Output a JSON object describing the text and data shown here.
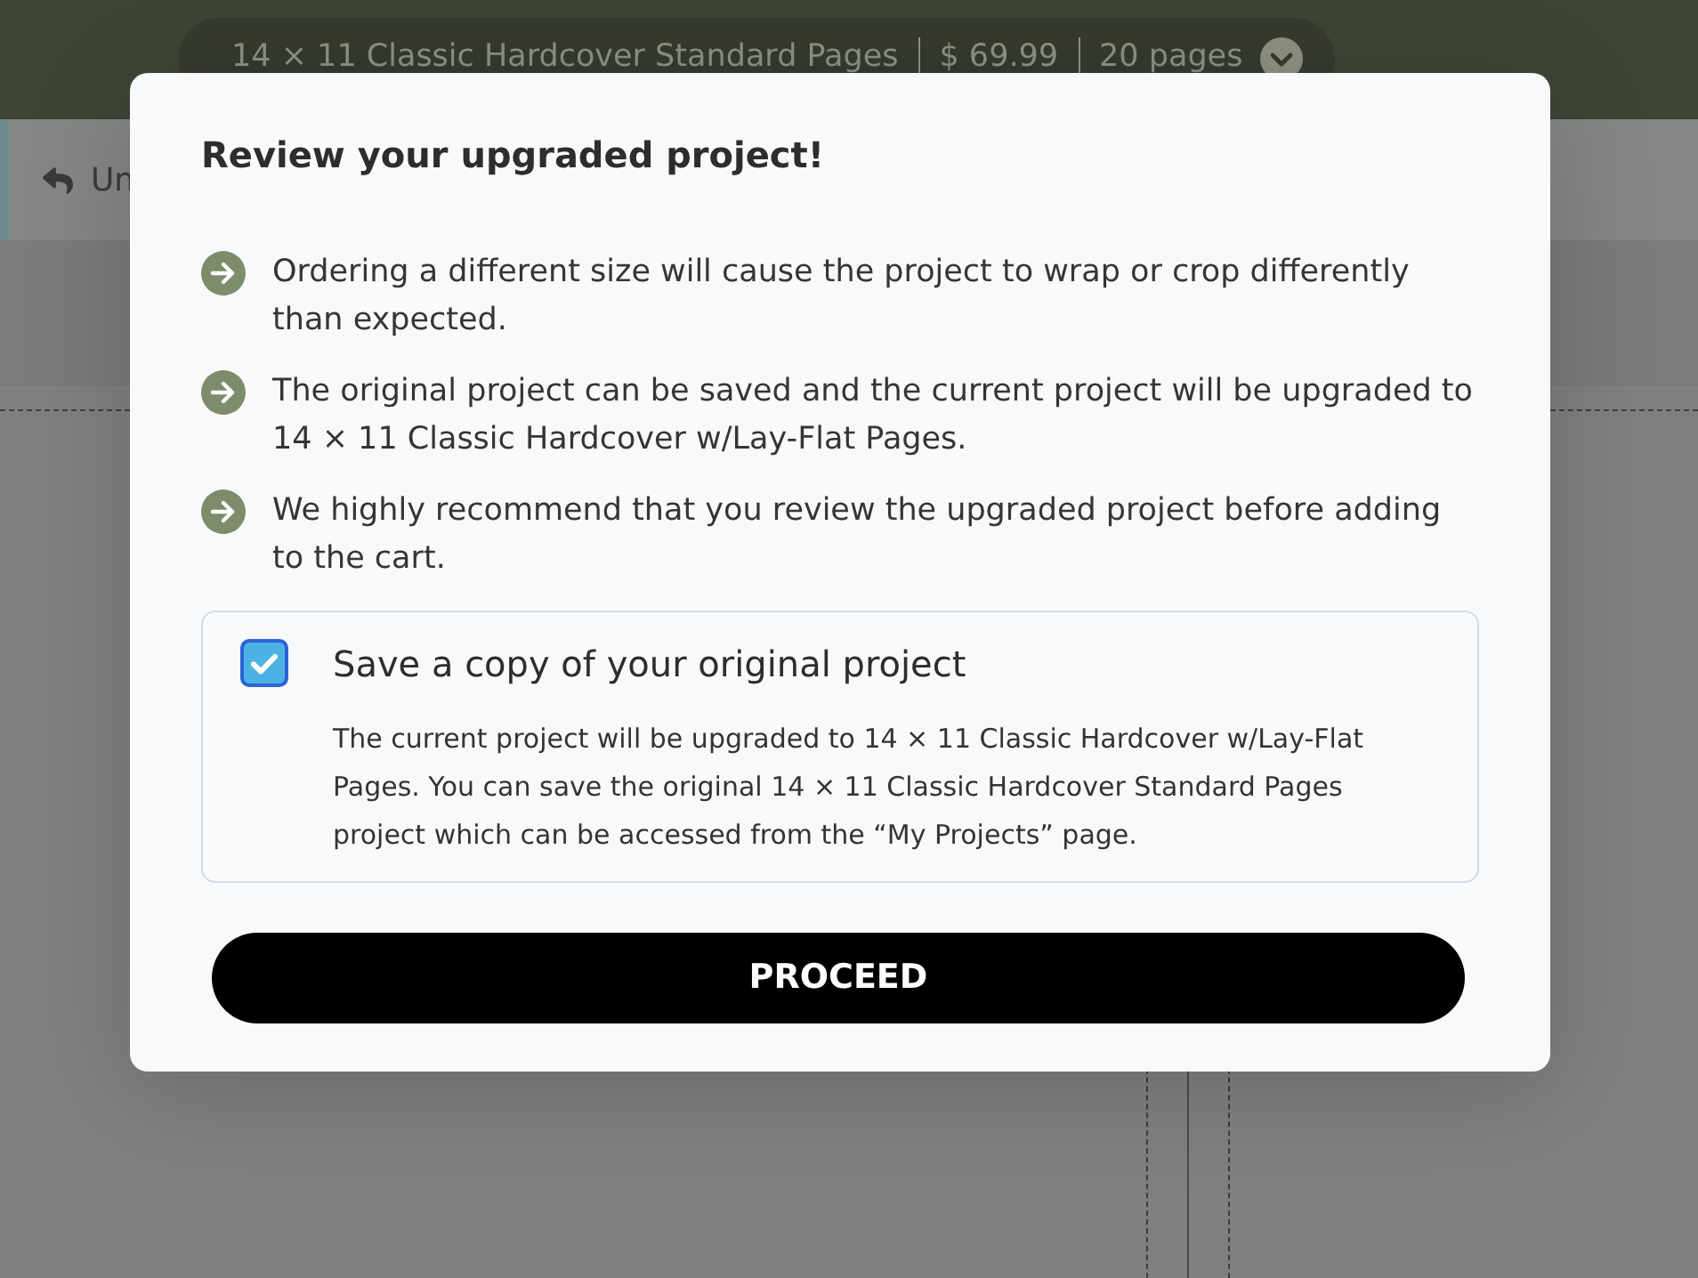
{
  "header": {
    "product": "14 × 11 Classic Hardcover Standard Pages",
    "price": "$ 69.99",
    "pages": "20 pages"
  },
  "toolbar": {
    "undo_label": "Un"
  },
  "dialog": {
    "title": "Review your upgraded project!",
    "bullets": [
      "Ordering a different size will cause the project to wrap or crop differently than expected.",
      "The original project can be saved and the current project will be upgraded to 14 × 11 Classic Hardcover w/Lay-Flat Pages.",
      "We highly recommend that you review the upgraded project before adding to the cart."
    ],
    "save_copy": {
      "checked": true,
      "label": "Save a copy of your original project",
      "description": "The current project will be upgraded to 14 × 11 Classic Hardcover w/Lay-Flat Pages. You can save the original 14 × 11 Classic Hardcover Standard Pages project which can be accessed from the “My Projects” page."
    },
    "button": "PROCEED"
  }
}
